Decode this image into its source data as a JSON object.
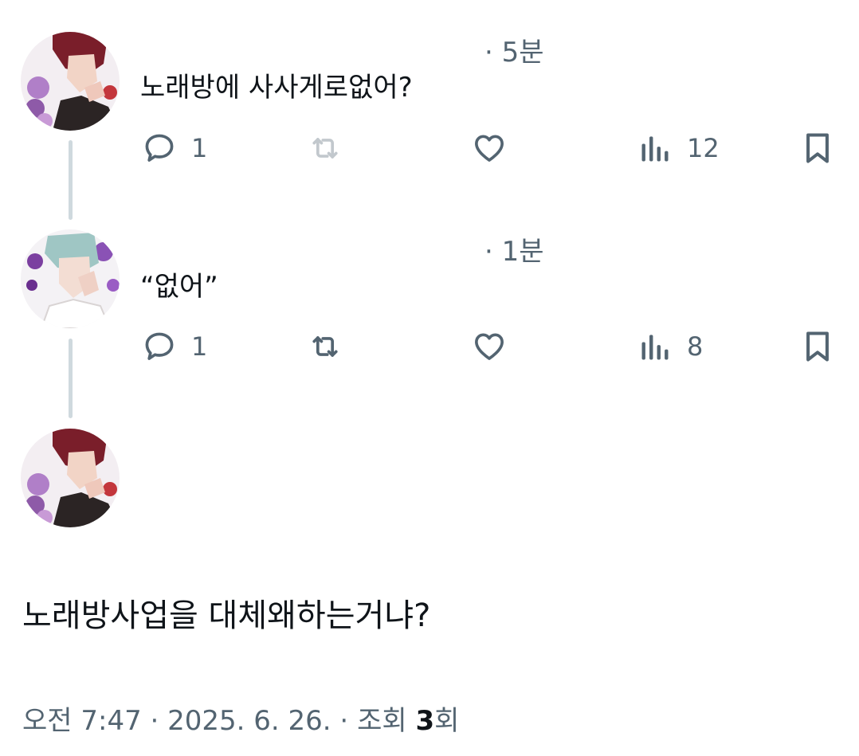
{
  "tweets": [
    {
      "time": "· 5분",
      "text": "노래방에 사사게로없어?",
      "replies": "1",
      "views": "12",
      "retweet_enabled": false
    },
    {
      "time": "· 1분",
      "text": "“없어”",
      "replies": "1",
      "views": "8",
      "retweet_enabled": true
    }
  ],
  "main_tweet": {
    "text": "노래방사업을 대체왜하는거냐?",
    "footer": {
      "time": "오전 7:47",
      "sep1": " · ",
      "date": "2025. 6. 26.",
      "sep2": " · ",
      "views_prefix": "조회 ",
      "views_count": "3",
      "views_suffix": "회"
    }
  },
  "icons": {
    "reply": "speech-bubble-icon",
    "retweet": "retweet-arrows-icon",
    "like": "heart-icon",
    "views": "bar-chart-icon",
    "bookmark": "bookmark-icon"
  },
  "colors": {
    "text": "#0f1419",
    "secondary": "#536471",
    "thread_line": "#cfd9de"
  }
}
